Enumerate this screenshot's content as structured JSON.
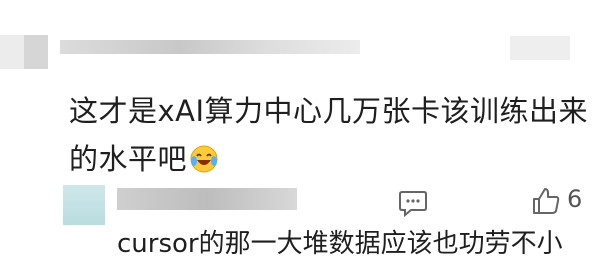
{
  "comment": {
    "text": "这才是xAI算力中心几万张卡该训练出来的水平吧",
    "emoji_icon": "laughing-tears-emoji-icon"
  },
  "reply": {
    "text": "cursor的那一大堆数据应该也功劳不小",
    "like_count": "6",
    "comment_icon": "comment-bubble-icon",
    "like_icon": "thumbs-up-icon"
  },
  "colors": {
    "text": "#1f1f1f",
    "icon": "#666666",
    "blur_gray": "#d9d9d9",
    "blur_teal": "#b9dde0"
  }
}
